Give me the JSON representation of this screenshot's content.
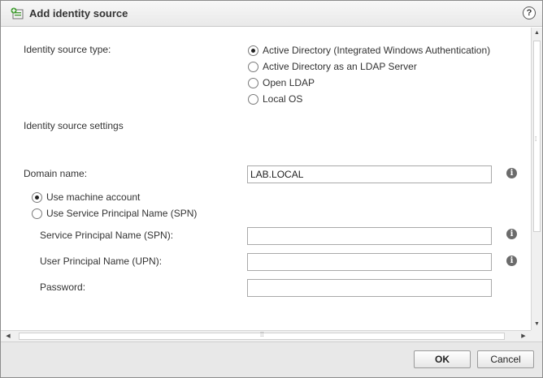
{
  "dialog": {
    "title": "Add identity source",
    "help_glyph": "?",
    "icon": "add-identity-source-icon"
  },
  "form": {
    "source_type_label": "Identity source type:",
    "source_types": [
      {
        "label": "Active Directory (Integrated Windows Authentication)",
        "selected": true
      },
      {
        "label": "Active Directory as an LDAP Server",
        "selected": false
      },
      {
        "label": "Open LDAP",
        "selected": false
      },
      {
        "label": "Local OS",
        "selected": false
      }
    ],
    "settings_heading": "Identity source settings",
    "domain_label": "Domain name:",
    "domain_value": "LAB.LOCAL",
    "account_options": [
      {
        "label": "Use machine account",
        "selected": true
      },
      {
        "label": "Use Service Principal Name (SPN)",
        "selected": false
      }
    ],
    "spn_label": "Service Principal Name (SPN):",
    "spn_value": "",
    "upn_label": "User Principal Name (UPN):",
    "upn_value": "",
    "password_label": "Password:",
    "password_value": "",
    "info_glyph": "i"
  },
  "footer": {
    "ok_label": "OK",
    "cancel_label": "Cancel"
  }
}
